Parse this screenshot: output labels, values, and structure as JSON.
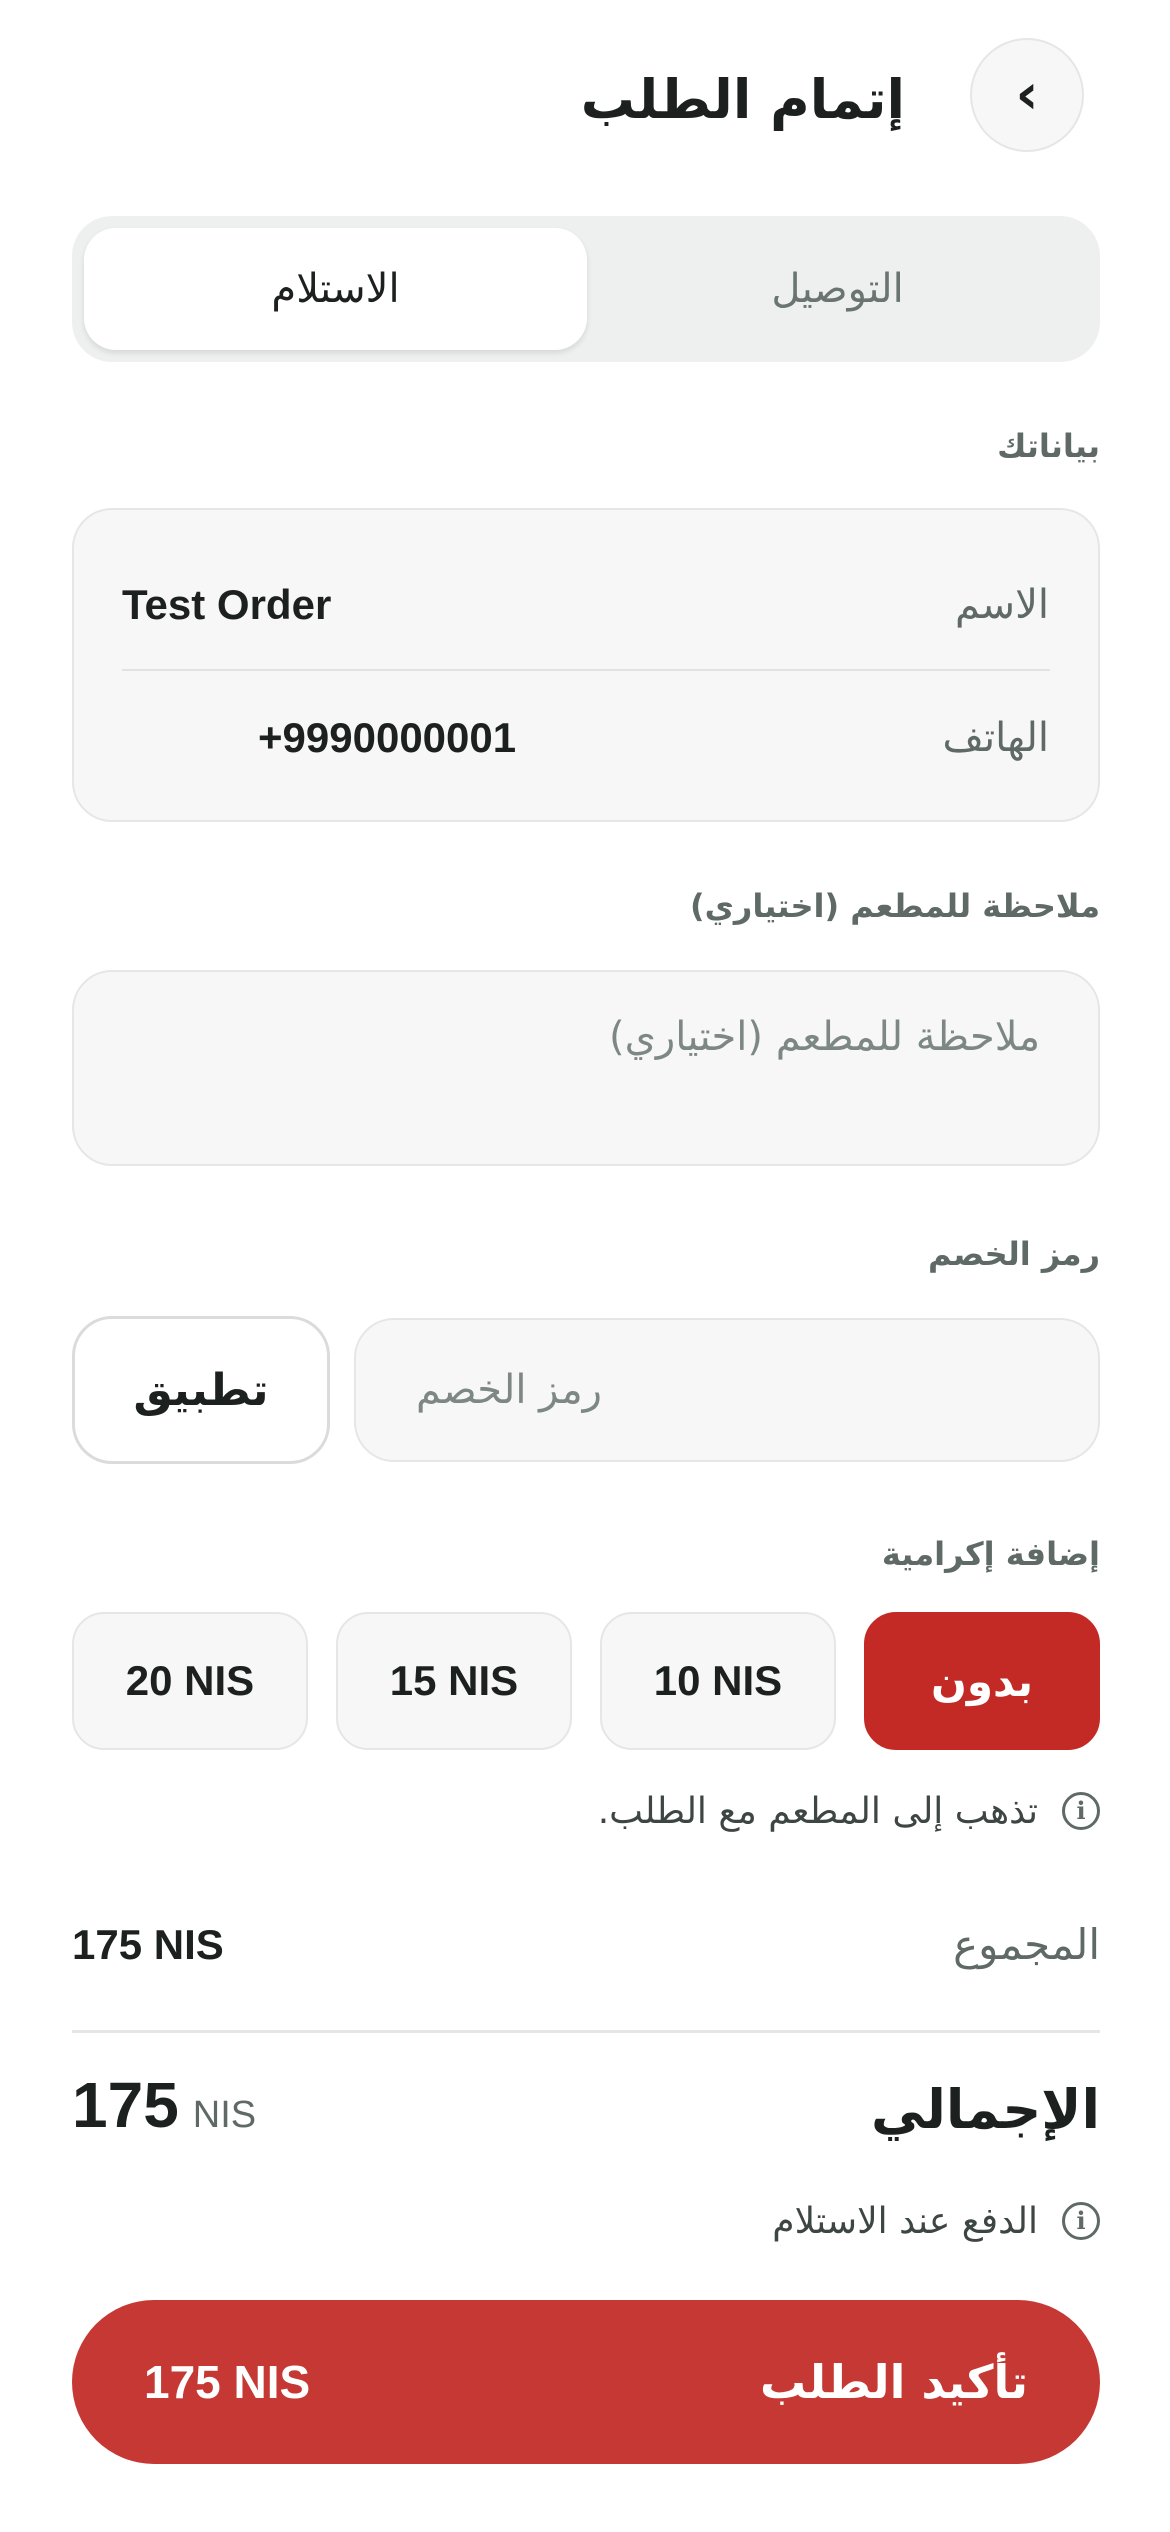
{
  "header": {
    "back_icon": "chevron-right-icon",
    "back_glyph": "›",
    "title": "إتمام الطلب"
  },
  "order_type": {
    "options": [
      {
        "label": "الاستلام",
        "selected": true
      },
      {
        "label": "التوصيل",
        "selected": false
      }
    ]
  },
  "customer": {
    "section_label": "بياناتك",
    "name_label": "الاسم",
    "name_value": "Test Order",
    "phone_label": "الهاتف",
    "phone_value": "+9990000001"
  },
  "note": {
    "section_label": "ملاحظة للمطعم (اختياري)",
    "placeholder": "ملاحظة للمطعم (اختياري)"
  },
  "discount": {
    "section_label": "رمز الخصم",
    "placeholder": "رمز الخصم",
    "apply_label": "تطبيق"
  },
  "tip": {
    "section_label": "إضافة إكرامية",
    "options": [
      "بدون",
      "10 NIS",
      "15 NIS",
      "20 NIS"
    ],
    "selected": "بدون",
    "info_text": "تذهب إلى المطعم مع الطلب."
  },
  "totals": {
    "subtotal_label": "المجموع",
    "subtotal_value": "175 NIS",
    "total_label": "الإجمالي",
    "total_amount": "175",
    "total_currency": "NIS",
    "payment_info": "الدفع عند الاستلام"
  },
  "confirm": {
    "label": "تأكيد الطلب",
    "amount": "175 NIS"
  },
  "colors": {
    "accent": "#c42a25",
    "confirm_bg": "#c53833",
    "surface": "#f6f7f6",
    "text": "#1c2120"
  }
}
